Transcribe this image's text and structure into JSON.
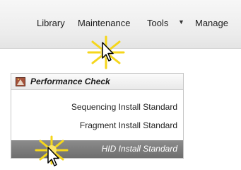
{
  "menubar": {
    "items": [
      {
        "label": "Library"
      },
      {
        "label": "Maintenance"
      },
      {
        "label": "Tools"
      },
      {
        "label": "Manage"
      }
    ],
    "tools_dropdown_glyph": "▼"
  },
  "panel": {
    "icon": "performance-check-icon",
    "title": "Performance Check",
    "items": [
      {
        "label": "Sequencing Install Standard",
        "highlighted": false
      },
      {
        "label": "Fragment Install Standard",
        "highlighted": false
      },
      {
        "label": "HID Install Standard",
        "highlighted": true
      }
    ]
  },
  "colors": {
    "highlight_row": "#7a7a7a",
    "burst": "#f5d61b",
    "menubar_bg": "#ececec"
  }
}
